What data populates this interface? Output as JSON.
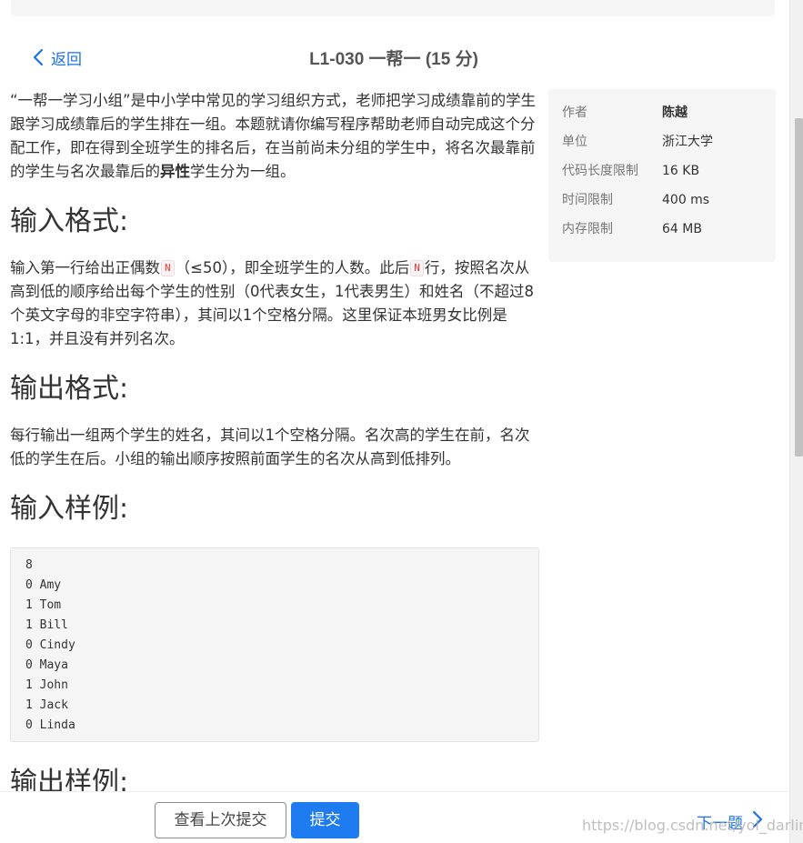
{
  "header": {
    "back_label": "返回",
    "title": "L1-030 一帮一 (15 分)"
  },
  "problem": {
    "description_parts": [
      "“一帮一学习小组”是中小学中常见的学习组织方式，老师把学习成绩靠前的学生跟学习成绩靠后的学生排在一组。本题就请你编写程序帮助老师自动完成这个分配工作，即在得到全班学生的排名后，在当前尚未分组的学生中，将名次最靠前的学生与名次最靠后的",
      "异性",
      "学生分为一组。"
    ],
    "input_heading": "输入格式:",
    "input_parts": [
      "输入第一行给出正偶数",
      "N",
      "（≤50），即全班学生的人数。此后",
      "N",
      "行，按照名次从高到低的顺序给出每个学生的性别（0代表女生，1代表男生）和姓名（不超过8个英文字母的非空字符串），其间以1个空格分隔。这里保证本班男女比例是1:1，并且没有并列名次。"
    ],
    "output_heading": "输出格式:",
    "output_text": "每行输出一组两个学生的姓名，其间以1个空格分隔。名次高的学生在前，名次低的学生在后。小组的输出顺序按照前面学生的名次从高到低排列。",
    "sample_input_heading": "输入样例:",
    "sample_input_lines": [
      "8",
      "0 Amy",
      "1 Tom",
      "1 Bill",
      "0 Cindy",
      "0 Maya",
      "1 John",
      "1 Jack",
      "0 Linda"
    ],
    "sample_output_heading": "输出样例:"
  },
  "info": [
    {
      "label": "作者",
      "value": "陈越"
    },
    {
      "label": "单位",
      "value": "浙江大学"
    },
    {
      "label": "代码长度限制",
      "value": "16 KB"
    },
    {
      "label": "时间限制",
      "value": "400 ms"
    },
    {
      "label": "内存限制",
      "value": "64 MB"
    }
  ],
  "footer": {
    "history_label": "查看上次提交",
    "submit_label": "提交",
    "next_label": "下一题"
  },
  "watermark": "https://blog.csdn.net/yol_darling",
  "colors": {
    "link": "#1a73e8",
    "submit_button": "#1e7bf0",
    "code_inline": "#e53935",
    "panel_bg": "#f5f5f5"
  },
  "icons": {
    "back": "chevron-left-icon",
    "next": "chevron-right-icon"
  }
}
